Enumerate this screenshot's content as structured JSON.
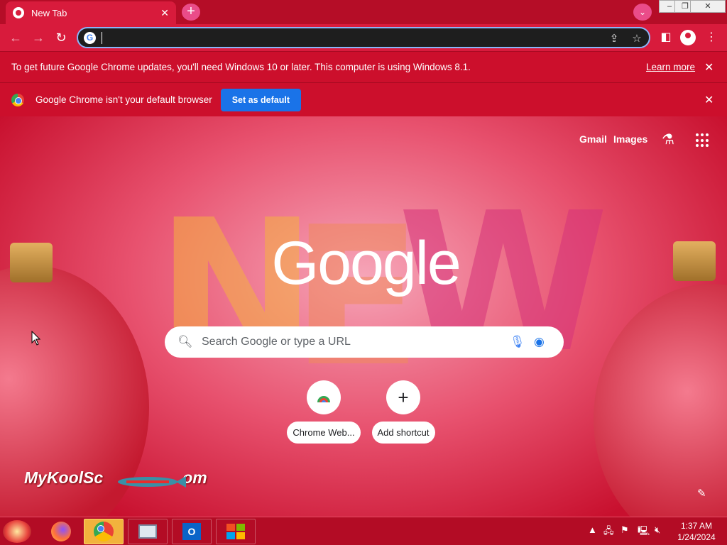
{
  "window": {
    "tab_title": "New Tab",
    "controls": {
      "minimize": "–",
      "restore": "❐",
      "close": "✕"
    }
  },
  "toolbar": {
    "omnibox_value": "",
    "icons": [
      "back-icon",
      "forward-icon",
      "reload-icon",
      "share-icon",
      "bookmark-star-icon",
      "side-panel-icon",
      "profile-icon",
      "menu-icon"
    ]
  },
  "infobars": {
    "update": {
      "message": "To get future Google Chrome updates, you'll need Windows 10 or later. This computer is using Windows 8.1.",
      "link": "Learn more"
    },
    "default_browser": {
      "message": "Google Chrome isn't your default browser",
      "button": "Set as default"
    }
  },
  "ntp": {
    "links": {
      "gmail": "Gmail",
      "images": "Images"
    },
    "logo": "Google",
    "search_placeholder": "Search Google or type a URL",
    "shortcuts": [
      {
        "label": "Chrome Web...",
        "icon": "chrome-web-store-icon"
      },
      {
        "label": "Add shortcut",
        "icon": "plus-icon"
      }
    ],
    "background_letters": [
      "N",
      "E",
      "W"
    ],
    "watermark": "MyKoolSc",
    "watermark_tail": "om"
  },
  "taskbar": {
    "apps": [
      "firefox-icon",
      "chrome-icon",
      "system-monitor-icon",
      "outlook-icon",
      "windows-flag-icon"
    ],
    "time": "1:37 AM",
    "date": "1/24/2024"
  },
  "colors": {
    "accent": "#d81b3c",
    "omnibox_border": "#8ab4f8",
    "set_default_button": "#1a73e8"
  }
}
